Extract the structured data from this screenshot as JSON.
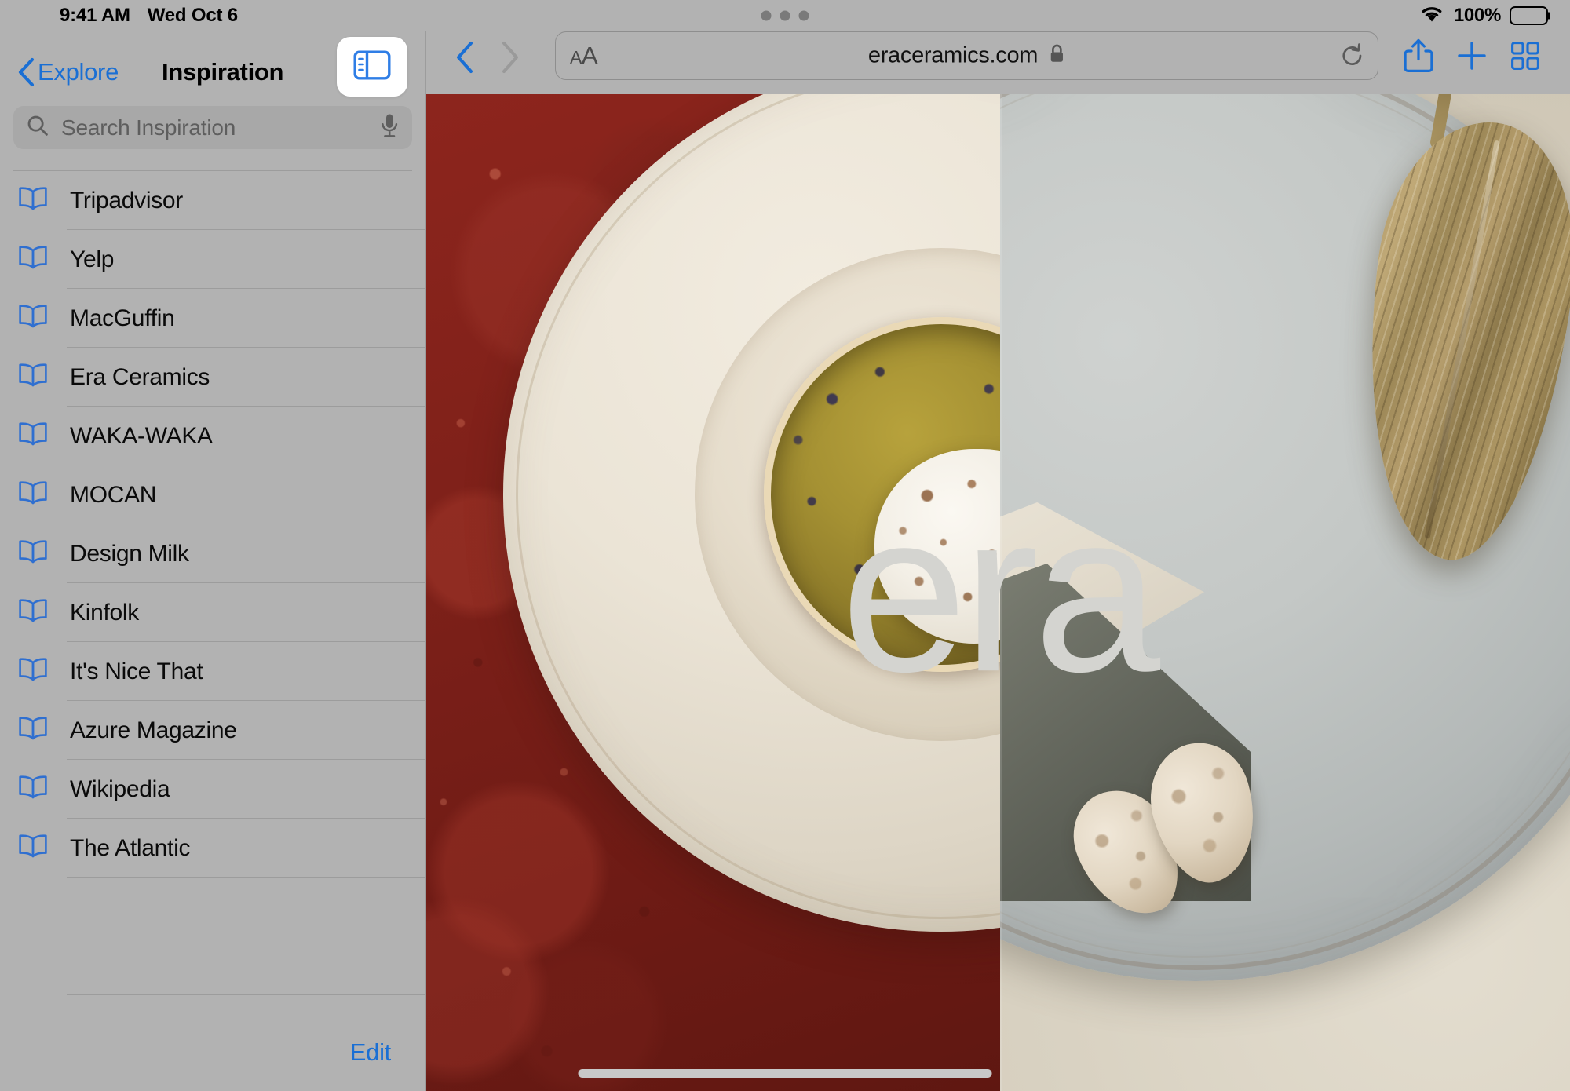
{
  "status_bar": {
    "time": "9:41 AM",
    "date": "Wed Oct 6",
    "battery_percent": "100%",
    "wifi_icon": "wifi-icon",
    "battery_icon": "battery-full-icon",
    "grabber_icon": "multitasking-grabber-icon"
  },
  "sidebar": {
    "back_label": "Explore",
    "back_icon": "chevron-left-icon",
    "title": "Inspiration",
    "toggle_icon": "sidebar-toggle-icon",
    "search": {
      "placeholder": "Search Inspiration",
      "search_icon": "search-icon",
      "mic_icon": "microphone-icon"
    },
    "items": [
      {
        "label": "Tripadvisor",
        "icon": "bookmark-book-icon"
      },
      {
        "label": "Yelp",
        "icon": "bookmark-book-icon"
      },
      {
        "label": "MacGuffin",
        "icon": "bookmark-book-icon"
      },
      {
        "label": "Era Ceramics",
        "icon": "bookmark-book-icon"
      },
      {
        "label": "WAKA-WAKA",
        "icon": "bookmark-book-icon"
      },
      {
        "label": "MOCAN",
        "icon": "bookmark-book-icon"
      },
      {
        "label": "Design Milk",
        "icon": "bookmark-book-icon"
      },
      {
        "label": "Kinfolk",
        "icon": "bookmark-book-icon"
      },
      {
        "label": "It's Nice That",
        "icon": "bookmark-book-icon"
      },
      {
        "label": "Azure Magazine",
        "icon": "bookmark-book-icon"
      },
      {
        "label": "Wikipedia",
        "icon": "bookmark-book-icon"
      },
      {
        "label": "The Atlantic",
        "icon": "bookmark-book-icon"
      }
    ],
    "edit_label": "Edit"
  },
  "browser": {
    "back_icon": "chevron-left-icon",
    "forward_icon": "chevron-right-icon",
    "text_size_label_small": "A",
    "text_size_label_large": "A",
    "url": "eraceramics.com",
    "lock_icon": "lock-icon",
    "reload_icon": "reload-icon",
    "share_icon": "share-icon",
    "new_tab_icon": "plus-icon",
    "tab_overview_icon": "tab-grid-icon"
  },
  "page": {
    "wordmark": "era",
    "site_name": "Era Ceramics"
  },
  "colors": {
    "accent_blue": "#1a6fd4",
    "chrome_gray": "#b2b2b2",
    "separator": "#9c9c9c",
    "ochre_red": "#7d2019",
    "plate_cream": "#ebe4d6",
    "plate_gray": "#c4c8c6",
    "wordmark_gray": "#d4d4d0"
  },
  "home_indicator": "home-indicator"
}
